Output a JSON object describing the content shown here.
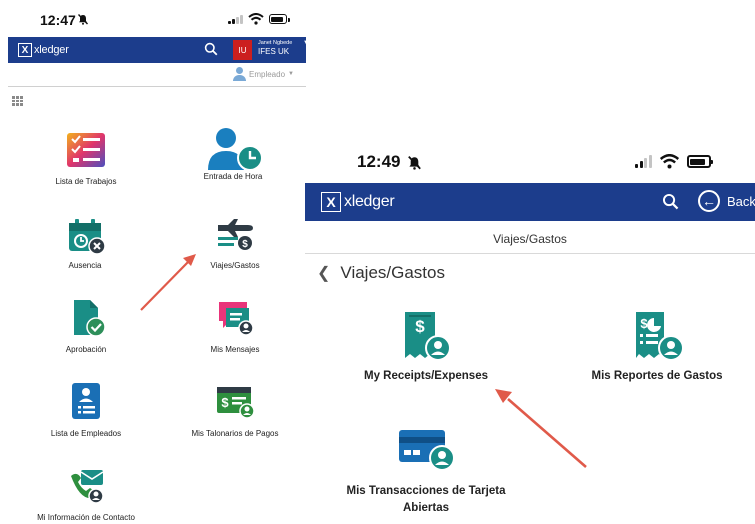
{
  "left_phone": {
    "time": "12:47",
    "brand": "xledger",
    "user_initials": "IU",
    "user_name": "Janet Ngbede",
    "user_org": "IFES UK",
    "role": "Empleado",
    "tiles": [
      {
        "label": "Lista de Trabajos",
        "icon": "task-list-icon"
      },
      {
        "label": "Entrada de Hora",
        "icon": "time-entry-icon"
      },
      {
        "label": "Ausencia",
        "icon": "absence-calendar-icon"
      },
      {
        "label": "Viajes/Gastos",
        "icon": "travel-expense-icon"
      },
      {
        "label": "Aprobación",
        "icon": "approval-document-icon"
      },
      {
        "label": "Mis Mensajes",
        "icon": "messages-icon"
      },
      {
        "label": "Lista de Empleados",
        "icon": "employee-list-icon"
      },
      {
        "label": "Mis Talonarios de Pagos",
        "icon": "payslip-icon"
      },
      {
        "label": "Mi Información de Contacto",
        "icon": "contact-info-icon"
      }
    ]
  },
  "right_phone": {
    "time": "12:49",
    "brand": "xledger",
    "back_label": "Back",
    "page_title": "Viajes/Gastos",
    "breadcrumb": "Viajes/Gastos",
    "tiles": [
      {
        "label": "My Receipts/Expenses",
        "icon": "receipt-icon"
      },
      {
        "label": "Mis Reportes de Gastos",
        "icon": "expense-report-icon"
      },
      {
        "label_line1": "Mis Transacciones de Tarjeta",
        "label_line2": "Abiertas",
        "icon": "card-transactions-icon"
      }
    ]
  },
  "colors": {
    "brand_bar": "#1c3d8c",
    "teal": "#1a8e86",
    "accent_red": "#e05540",
    "arrow": "#e05a4a"
  }
}
